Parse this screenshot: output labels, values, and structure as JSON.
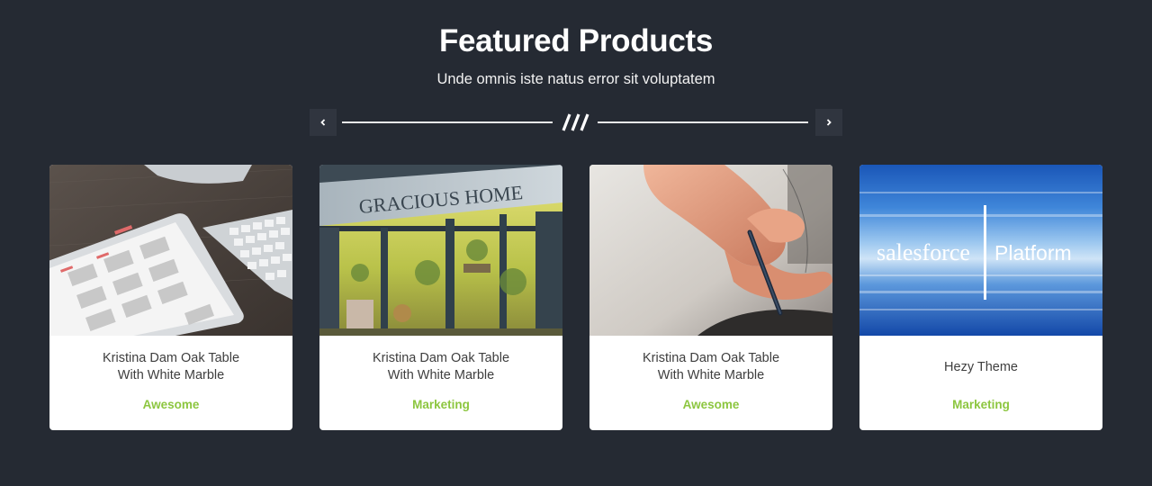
{
  "section": {
    "title": "Featured Products",
    "subtitle": "Unde omnis iste natus error sit voluptatem"
  },
  "carousel": {
    "prev_icon": "chevron-left-icon",
    "next_icon": "chevron-right-icon",
    "divider_icon": "triple-slash-icon"
  },
  "products": [
    {
      "image": "tablet-calendar-keyboard-photo",
      "name_line1": "Kristina Dam Oak Table",
      "name_line2": "With White Marble",
      "category": "Awesome"
    },
    {
      "image": "gracious-home-storefront-photo",
      "image_text": "GRACIOUS HOME",
      "name_line1": "Kristina Dam Oak Table",
      "name_line2": "With White Marble",
      "category": "Marketing"
    },
    {
      "image": "hand-stylus-tablet-photo",
      "name_line1": "Kristina Dam Oak Table",
      "name_line2": "With White Marble",
      "category": "Awesome"
    },
    {
      "image": "salesforce-platform-logo",
      "logo_text_left": "salesforce",
      "logo_text_right": "Platform",
      "name_line1": "Hezy Theme",
      "category": "Marketing"
    }
  ],
  "colors": {
    "background": "#252a33",
    "accent": "#8cc63f",
    "card": "#ffffff",
    "nav_button": "#30353f"
  }
}
